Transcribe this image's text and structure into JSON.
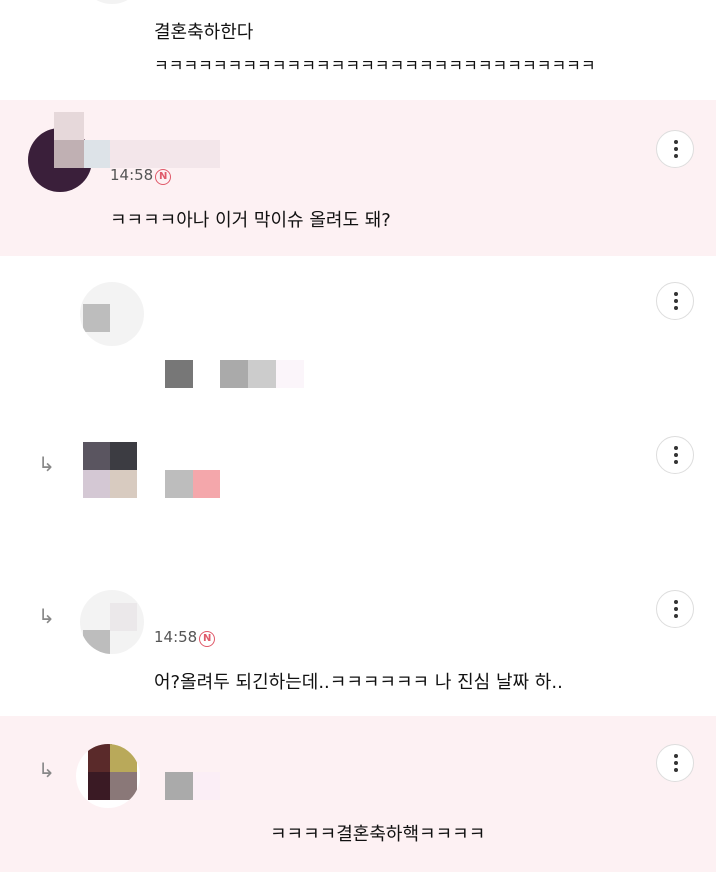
{
  "comments": [
    {
      "lines": [
        "결혼축하한다",
        "ㅋㅋㅋㅋㅋㅋㅋㅋㅋㅋㅋㅋㅋㅋㅋㅋㅋㅋㅋㅋㅋㅋㅋㅋㅋㅋㅋㅋㅋㅋ"
      ]
    },
    {
      "time": "14:58",
      "badge": "N",
      "text": "ㅋㅋㅋㅋ아나 이거 막이슈 올려도 돼?"
    },
    {
      "text": ""
    },
    {
      "text": ""
    },
    {
      "time": "14:58",
      "badge": "N",
      "text": "어?올려두 되긴하는데..ㅋㅋㅋㅋㅋㅋ 나 진심 날짜 하.."
    },
    {
      "text": "ㅋㅋㅋㅋ결혼축하핵ㅋㅋㅋㅋ"
    }
  ],
  "icons": {
    "more": "more-vertical-icon",
    "reply": "reply-arrow-icon",
    "new_badge": "new-badge-icon"
  },
  "colors": {
    "highlight_bg": "#fdf1f3",
    "badge": "#e05a6a"
  }
}
